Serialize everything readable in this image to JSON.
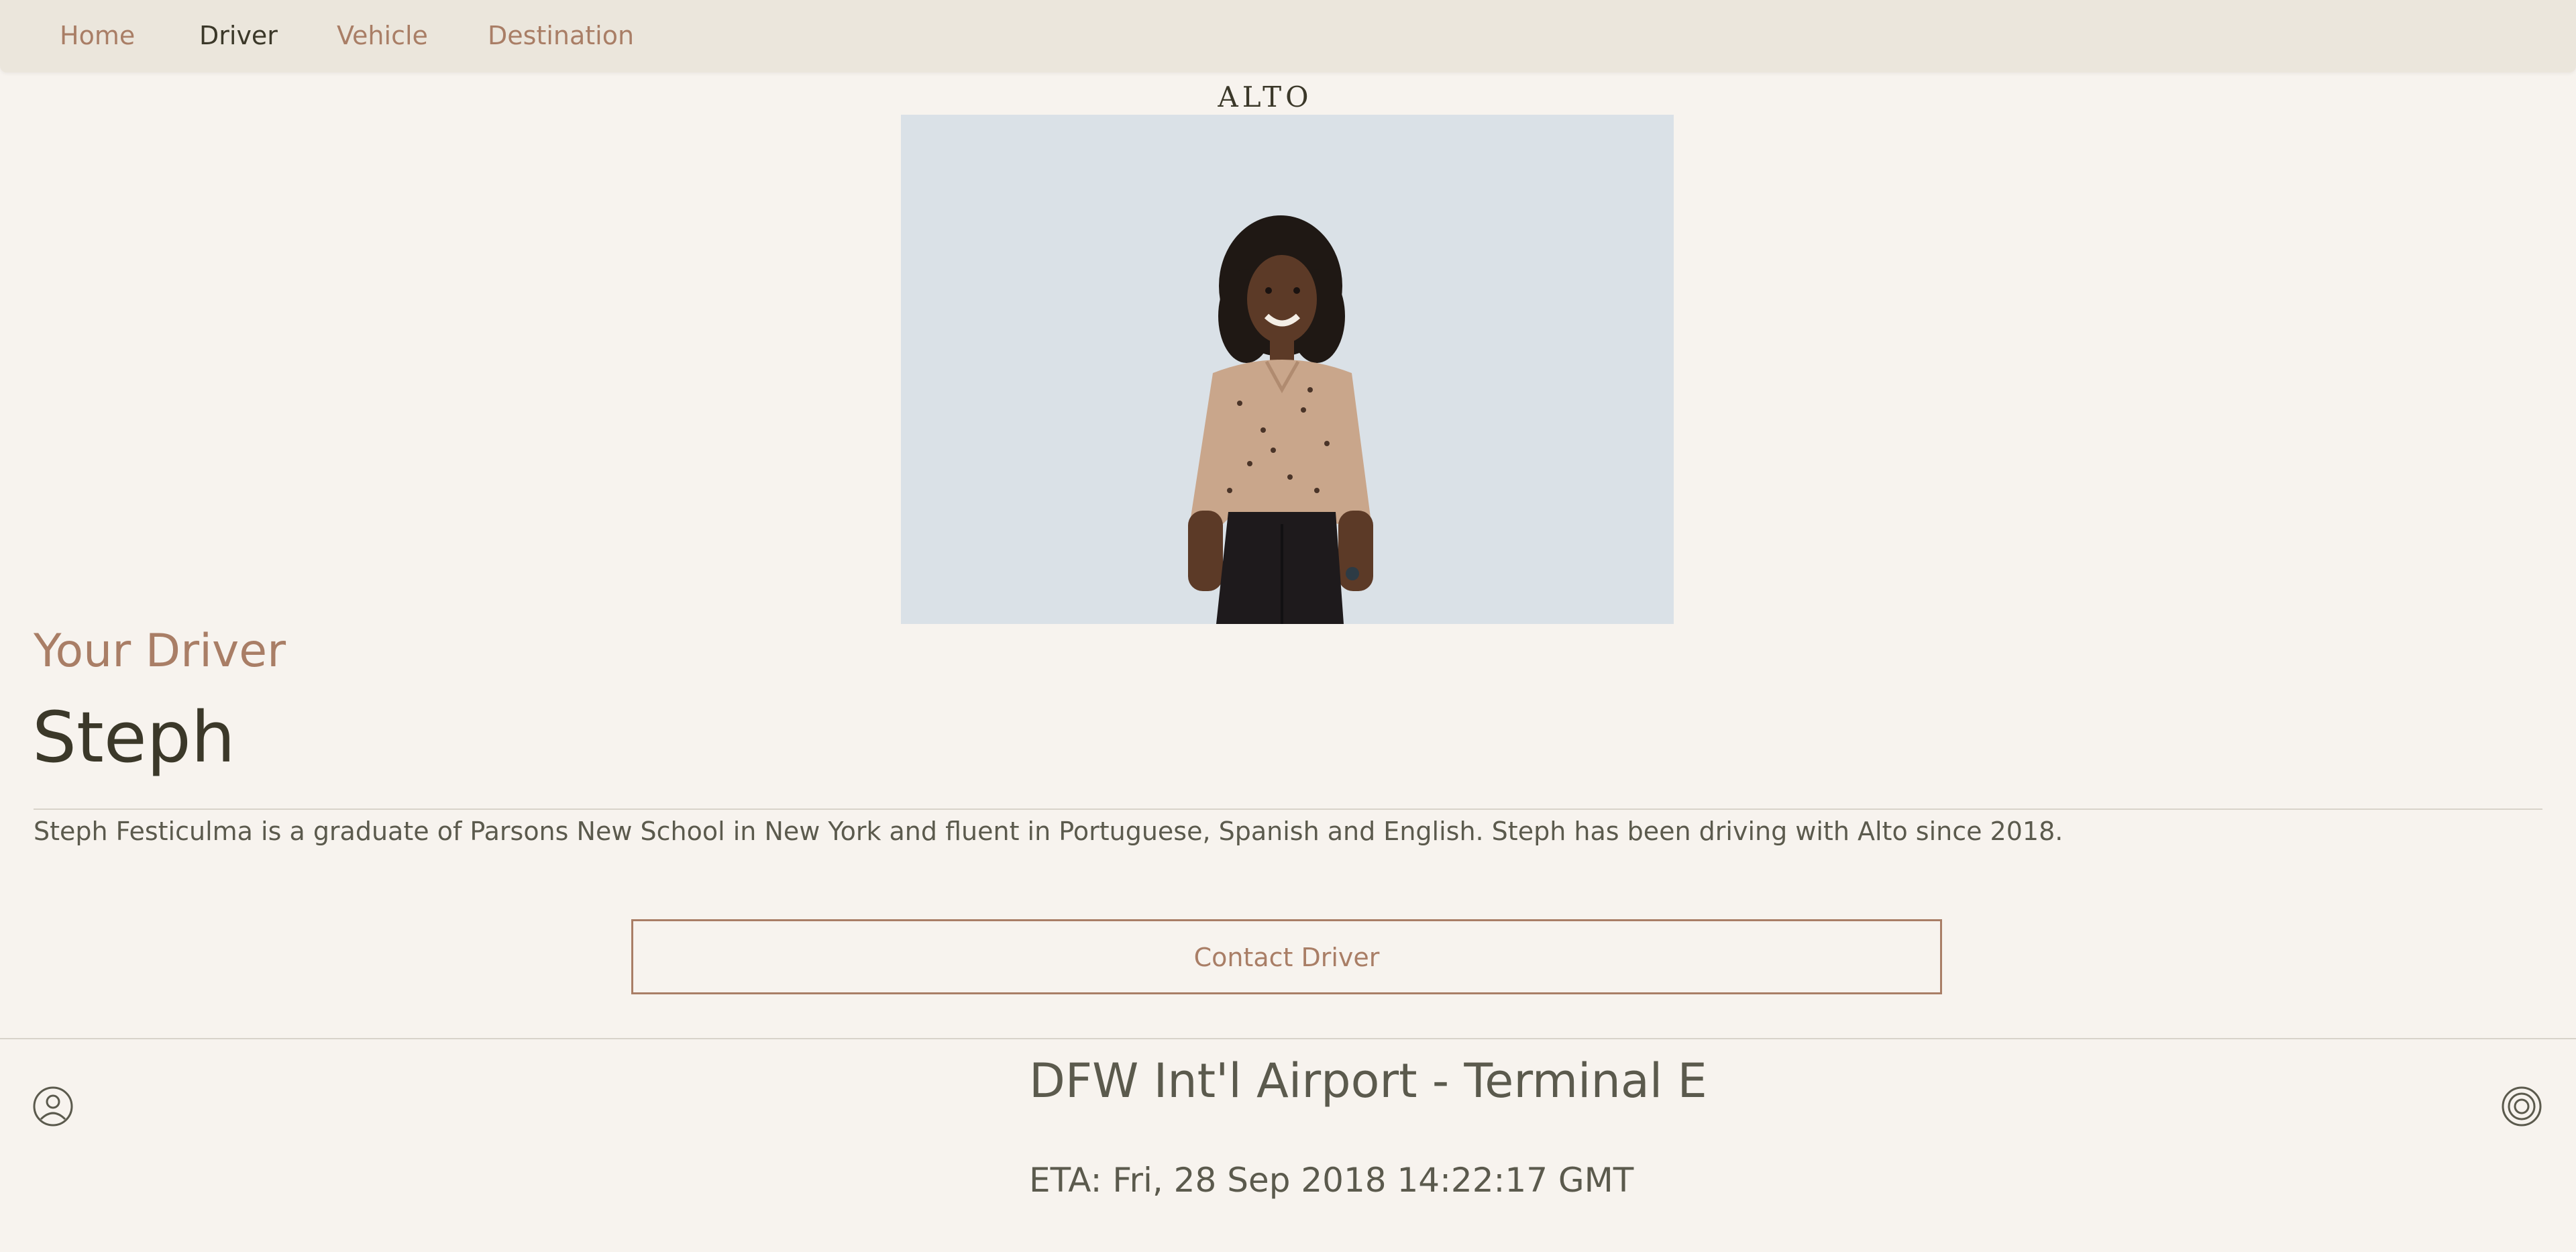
{
  "nav": {
    "items": [
      {
        "label": "Home",
        "active": false
      },
      {
        "label": "Driver",
        "active": true
      },
      {
        "label": "Vehicle",
        "active": false
      },
      {
        "label": "Destination",
        "active": false
      }
    ]
  },
  "brand": {
    "name": "ALTO"
  },
  "driver": {
    "section_label": "Your Driver",
    "name": "Steph",
    "bio": "Steph Festiculma is a graduate of Parsons New School in New York and fluent in Portuguese, Spanish and English. Steph has been driving with Alto since 2018.",
    "contact_label": "Contact Driver",
    "photo_icon": "driver-photo"
  },
  "trip": {
    "destination": "DFW Int'l Airport - Terminal E",
    "eta": "ETA: Fri, 28 Sep 2018 14:22:17 GMT"
  },
  "icons": {
    "left": "user-icon",
    "right": "target-icon"
  },
  "colors": {
    "background": "#f7f3ee",
    "nav_background": "#ebe6dc",
    "accent": "#a97e66",
    "text_dark": "#3b3829",
    "text_body": "#5b5a4d",
    "photo_background": "#dbe2e8"
  }
}
